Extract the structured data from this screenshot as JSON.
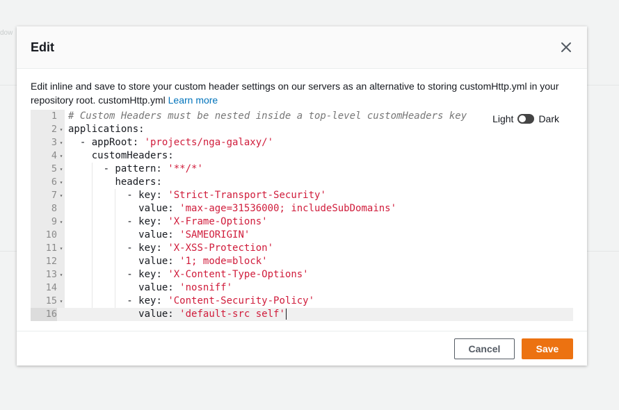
{
  "background": {
    "fragment": "dow"
  },
  "modal": {
    "title": "Edit",
    "description": "Edit inline and save to store your custom header settings on our servers as an alternative to storing customHttp.yml in your repository root. customHttp.yml",
    "learn_more": "Learn more"
  },
  "theme": {
    "light_label": "Light",
    "dark_label": "Dark",
    "selected": "Dark"
  },
  "editor": {
    "lines": [
      {
        "n": "1",
        "fold": "",
        "indent": 0,
        "tokens": [
          [
            "c",
            "# Custom Headers must be nested inside a top-level customHeaders key"
          ]
        ]
      },
      {
        "n": "2",
        "fold": "▾",
        "indent": 0,
        "tokens": [
          [
            "k",
            "applications:"
          ]
        ]
      },
      {
        "n": "3",
        "fold": "▾",
        "indent": 2,
        "tokens": [
          [
            "k",
            "- appRoot: "
          ],
          [
            "s",
            "'projects/nga-galaxy/'"
          ]
        ]
      },
      {
        "n": "4",
        "fold": "▾",
        "indent": 4,
        "tokens": [
          [
            "k",
            "customHeaders:"
          ]
        ]
      },
      {
        "n": "5",
        "fold": "▾",
        "indent": 6,
        "tokens": [
          [
            "k",
            "- pattern: "
          ],
          [
            "s",
            "'**/*'"
          ]
        ]
      },
      {
        "n": "6",
        "fold": "▾",
        "indent": 8,
        "tokens": [
          [
            "k",
            "headers:"
          ]
        ]
      },
      {
        "n": "7",
        "fold": "▾",
        "indent": 10,
        "tokens": [
          [
            "k",
            "- key: "
          ],
          [
            "s",
            "'Strict-Transport-Security'"
          ]
        ]
      },
      {
        "n": "8",
        "fold": "",
        "indent": 12,
        "tokens": [
          [
            "k",
            "value: "
          ],
          [
            "s",
            "'max-age=31536000; includeSubDomains'"
          ]
        ]
      },
      {
        "n": "9",
        "fold": "▾",
        "indent": 10,
        "tokens": [
          [
            "k",
            "- key: "
          ],
          [
            "s",
            "'X-Frame-Options'"
          ]
        ]
      },
      {
        "n": "10",
        "fold": "",
        "indent": 12,
        "tokens": [
          [
            "k",
            "value: "
          ],
          [
            "s",
            "'SAMEORIGIN'"
          ]
        ]
      },
      {
        "n": "11",
        "fold": "▾",
        "indent": 10,
        "tokens": [
          [
            "k",
            "- key: "
          ],
          [
            "s",
            "'X-XSS-Protection'"
          ]
        ]
      },
      {
        "n": "12",
        "fold": "",
        "indent": 12,
        "tokens": [
          [
            "k",
            "value: "
          ],
          [
            "s",
            "'1; mode=block'"
          ]
        ]
      },
      {
        "n": "13",
        "fold": "▾",
        "indent": 10,
        "tokens": [
          [
            "k",
            "- key: "
          ],
          [
            "s",
            "'X-Content-Type-Options'"
          ]
        ]
      },
      {
        "n": "14",
        "fold": "",
        "indent": 12,
        "tokens": [
          [
            "k",
            "value: "
          ],
          [
            "s",
            "'nosniff'"
          ]
        ]
      },
      {
        "n": "15",
        "fold": "▾",
        "indent": 10,
        "tokens": [
          [
            "k",
            "- key: "
          ],
          [
            "s",
            "'Content-Security-Policy'"
          ]
        ]
      },
      {
        "n": "16",
        "fold": "",
        "indent": 12,
        "tokens": [
          [
            "k",
            "value: "
          ],
          [
            "s",
            "'default-src self'"
          ]
        ]
      }
    ],
    "active_line": "16"
  },
  "footer": {
    "cancel_label": "Cancel",
    "save_label": "Save"
  },
  "colors": {
    "accent": "#ec7211",
    "link": "#0073bb",
    "string": "#d01c3b",
    "comment": "#777777"
  }
}
